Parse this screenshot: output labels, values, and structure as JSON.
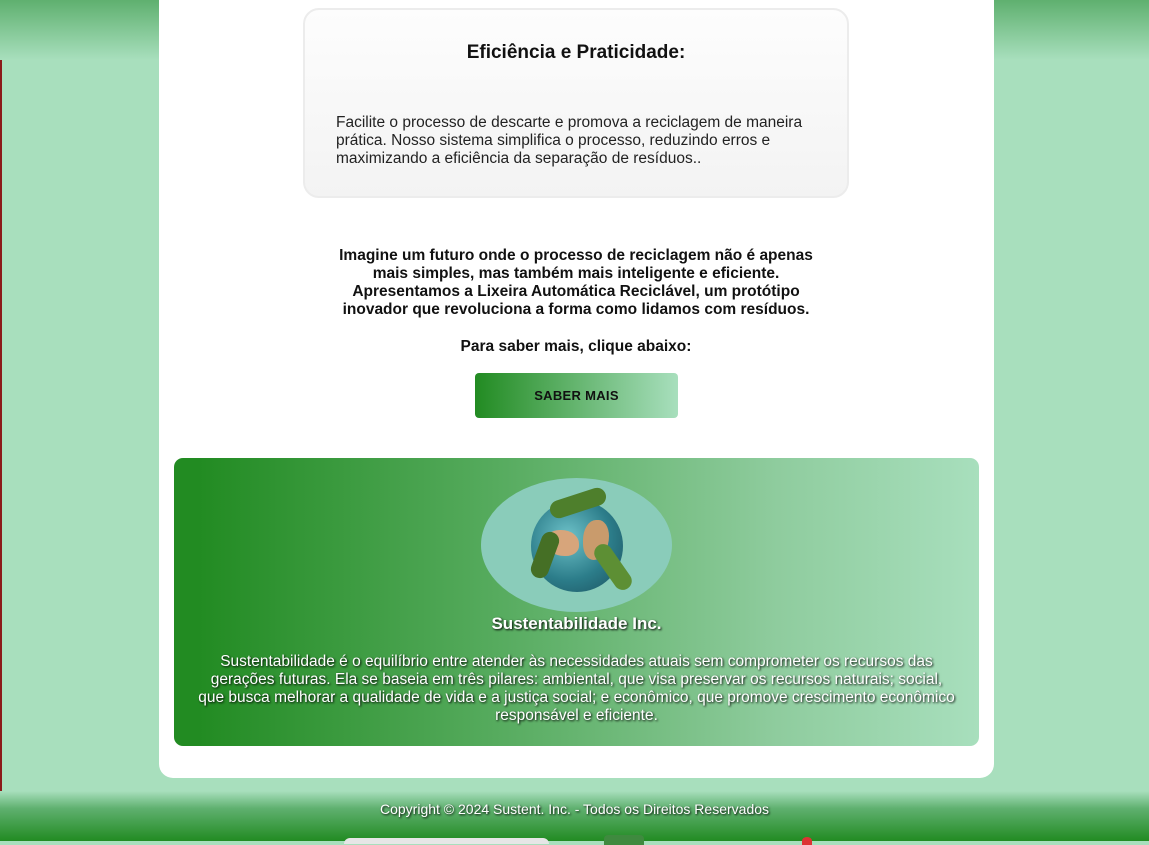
{
  "feature": {
    "title": "Eficiência e Praticidade:",
    "text": "Facilite o processo de descarte e promova a reciclagem de maneira prática. Nosso sistema simplifica o processo, reduzindo erros e maximizando a eficiência da separação de resíduos.."
  },
  "intro": {
    "text": "Imagine um futuro onde o processo de reciclagem não é apenas mais simples, mas também mais inteligente e eficiente. Apresentamos a Lixeira Automática Reciclável, um protótipo inovador que revoluciona a forma como lidamos com resíduos.",
    "cta_label": "Para saber mais, clique abaixo:",
    "cta_button": "SABER MAIS"
  },
  "about": {
    "logo_icon": "recycling-globe-icon",
    "title": "Sustentabilidade Inc.",
    "text": "Sustentabilidade é o equilíbrio entre atender às necessidades atuais sem comprometer os recursos das gerações futuras. Ela se baseia em três pilares: ambiental, que visa preservar os recursos naturais; social, que busca melhorar a qualidade de vida e a justiça social; e econômico, que promove crescimento econômico responsável e eficiente."
  },
  "footer": {
    "copyright": "Copyright © 2024 Sustent. Inc. - Todos os Direitos Reservados"
  },
  "colors": {
    "page_background": "#a8dfbd",
    "brand_green": "#228b22",
    "card_background": "#ffffff"
  }
}
